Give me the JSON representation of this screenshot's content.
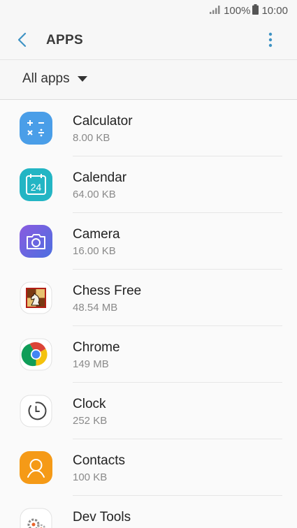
{
  "status_bar": {
    "battery": "100%",
    "time": "10:00"
  },
  "header": {
    "title": "APPS"
  },
  "filter": {
    "selected": "All apps"
  },
  "apps": [
    {
      "name": "Calculator",
      "size": "8.00 KB"
    },
    {
      "name": "Calendar",
      "size": "64.00 KB"
    },
    {
      "name": "Camera",
      "size": "16.00 KB"
    },
    {
      "name": "Chess Free",
      "size": "48.54 MB"
    },
    {
      "name": "Chrome",
      "size": "149 MB"
    },
    {
      "name": "Clock",
      "size": "252 KB"
    },
    {
      "name": "Contacts",
      "size": "100 KB"
    },
    {
      "name": "Dev Tools",
      "size": ""
    }
  ],
  "colors": {
    "accent": "#3f93c4"
  }
}
